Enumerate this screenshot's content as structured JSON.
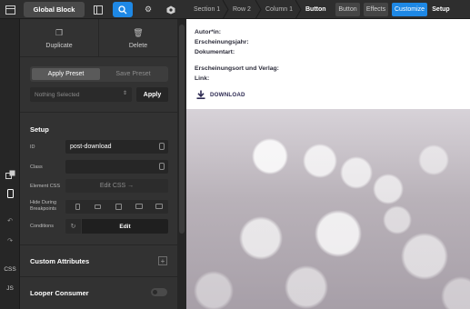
{
  "topbar": {
    "global_block_label": "Global Block",
    "breadcrumbs": [
      "Section 1",
      "Row 2",
      "Column 1",
      "Button"
    ],
    "tabs": [
      "Button",
      "Effects",
      "Customize",
      "Setup"
    ],
    "active_tab": "Customize",
    "accent_color": "#1e88e5"
  },
  "rail": {
    "items": [
      "stack-icon",
      "mobile-icon",
      "undo-icon",
      "redo-icon"
    ],
    "css_label": "CSS",
    "js_label": "JS"
  },
  "panel": {
    "duplicate_label": "Duplicate",
    "delete_label": "Delete",
    "apply_preset_label": "Apply Preset",
    "save_preset_label": "Save Preset",
    "preset_select_value": "Nothing Selected",
    "apply_label": "Apply",
    "setup_title": "Setup",
    "id_label": "ID",
    "id_value": "post-download",
    "class_label": "Class",
    "class_value": "",
    "element_css_label": "Element CSS",
    "edit_css_label": "Edit CSS →",
    "hide_label_1": "Hide During",
    "hide_label_2": "Breakpoints",
    "conditions_label": "Conditions",
    "conditions_edit_label": "Edit",
    "custom_attributes_label": "Custom Attributes",
    "looper_consumer_label": "Looper Consumer"
  },
  "preview": {
    "fields": [
      "Autor*in:",
      "Erscheinungsjahr:",
      "Dokumentart:",
      "Erscheinungsort und Verlag:",
      "Link:"
    ],
    "download_label": "DOWNLOAD"
  }
}
